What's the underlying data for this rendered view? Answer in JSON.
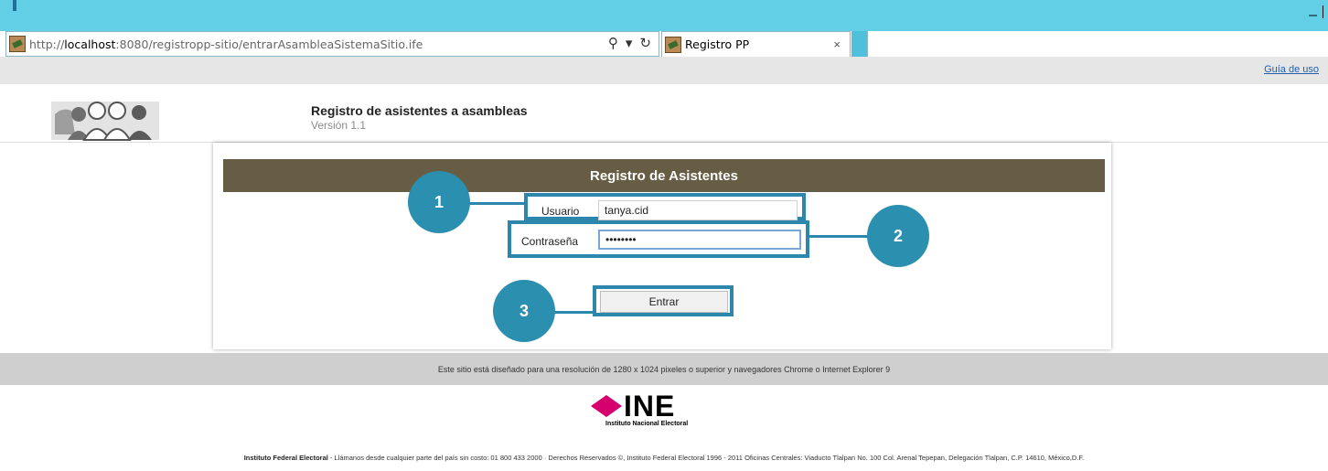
{
  "browser": {
    "url_prefix": "http://",
    "url_host": "localhost",
    "url_rest": ":8080/registropp-sitio/entrarAsambleaSistemaSitio.ife",
    "tab_title": "Registro PP",
    "tab_close": "×",
    "search_icon": "⚲",
    "dropdown_icon": "▾",
    "refresh_icon": "↻",
    "minimize_icon": "–",
    "home_icon": "⌂"
  },
  "header": {
    "guide_link": "Guía de uso",
    "app_title": "Registro de asistentes a asambleas",
    "version": "Versión 1.1"
  },
  "form": {
    "title": "Registro de Asistentes",
    "user_label": "Usuario",
    "user_value": "tanya.cid",
    "password_label": "Contraseña",
    "password_value": "••••••••",
    "submit_label": "Entrar"
  },
  "callouts": {
    "one": "1",
    "two": "2",
    "three": "3"
  },
  "footer": {
    "notice": "Este sitio está diseñado para una resolución de 1280 x 1024 pixeles o superior y navegadores Chrome o Internet Explorer 9",
    "logo_text": "INE",
    "logo_subtitle": "Instituto Nacional Electoral",
    "org_name": "Instituto Federal Electoral",
    "org_details": " - Llámanos desde cualquier parte del país sin costo: 01 800 433 2000 · Derechos Reservados ©, Instituto Federal Electoral 1996 - 2011 Oficinas Centrales: Viaducto Tlalpan No. 100 Col. Arenal Tepepan, Delegación Tlalpan, C.P. 14610, México,D.F."
  },
  "colors": {
    "titlebar": "#62cfe6",
    "form_header": "#675d44",
    "callout": "#2b8fb0",
    "ine_pink": "#d6006f"
  }
}
